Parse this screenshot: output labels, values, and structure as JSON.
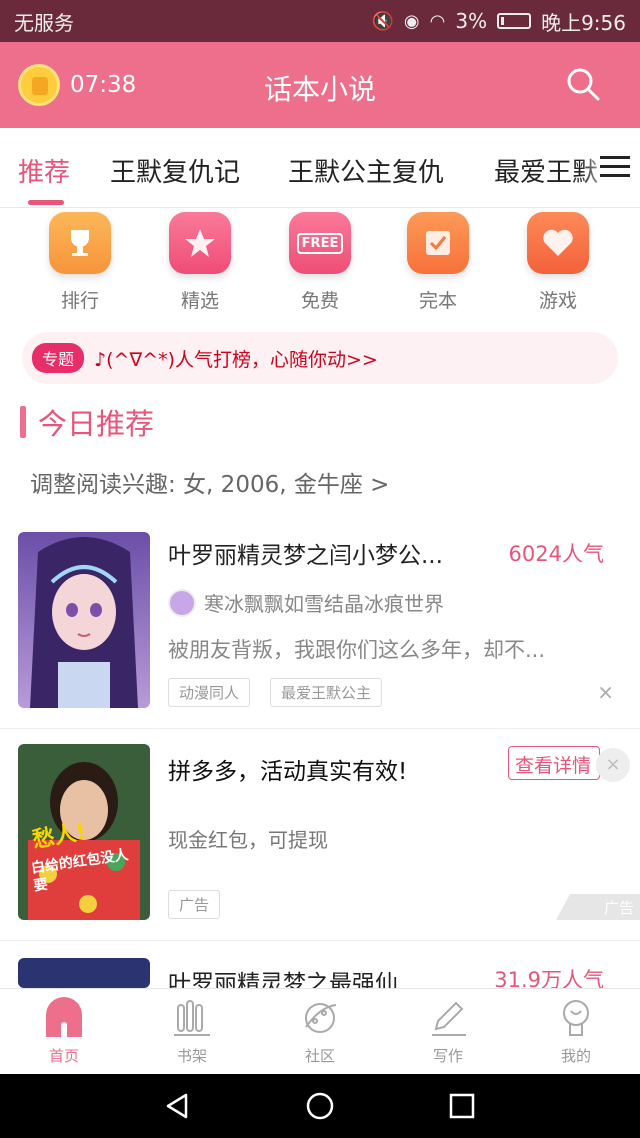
{
  "status_bar": {
    "carrier": "无服务",
    "battery": "3%",
    "time": "晚上9:56"
  },
  "header": {
    "alarm_time": "07:38",
    "title": "话本小说"
  },
  "tabs": [
    {
      "label": "推荐",
      "active": true
    },
    {
      "label": "王默复仇记",
      "active": false
    },
    {
      "label": "王默公主复仇",
      "active": false
    },
    {
      "label": "最爱王默",
      "active": false
    }
  ],
  "categories": [
    {
      "label": "排行",
      "icon": "trophy-icon",
      "color": "#f7a13b"
    },
    {
      "label": "精选",
      "icon": "star-icon",
      "color": "#f2557f"
    },
    {
      "label": "免费",
      "icon": "free-icon",
      "color": "#f05a7e",
      "badge": "FREE"
    },
    {
      "label": "完本",
      "icon": "check-icon",
      "color": "#f7793b"
    },
    {
      "label": "游戏",
      "icon": "heart-icon",
      "color": "#f7693b"
    }
  ],
  "banner": {
    "tag": "专题",
    "text": "♪(^∇^*)人气打榜，心随你动>>"
  },
  "section": {
    "title": "今日推荐",
    "preference": "调整阅读兴趣: 女, 2006, 金牛座 >"
  },
  "books": [
    {
      "title": "叶罗丽精灵梦之闫小梦公...",
      "popularity": "6024人气",
      "author": "寒冰飘飘如雪结晶冰痕世界",
      "description": "被朋友背叛，我跟你们这么多年，却不...",
      "tags": [
        "动漫同人",
        "最爱王默公主"
      ],
      "close": "×"
    },
    {
      "title": "叶罗丽精灵梦之最强仙...",
      "popularity": "31.9万人气"
    }
  ],
  "ad": {
    "title": "拼多多，活动真实有效!",
    "subtitle": "现金红包，可提现",
    "tag": "广告",
    "button": "查看详情",
    "mark": "广告",
    "close": "×",
    "image_caption": "愁人!",
    "image_text": "白给的红包没人要"
  },
  "bottom_nav": [
    {
      "label": "首页",
      "icon": "home-icon",
      "active": true
    },
    {
      "label": "书架",
      "icon": "bookshelf-icon",
      "active": false
    },
    {
      "label": "社区",
      "icon": "planet-icon",
      "active": false
    },
    {
      "label": "写作",
      "icon": "pen-icon",
      "active": false
    },
    {
      "label": "我的",
      "icon": "profile-icon",
      "active": false
    }
  ],
  "colors": {
    "status_bar": "#6b2a3c",
    "header": "#ed6f8c",
    "accent": "#e8557a"
  }
}
